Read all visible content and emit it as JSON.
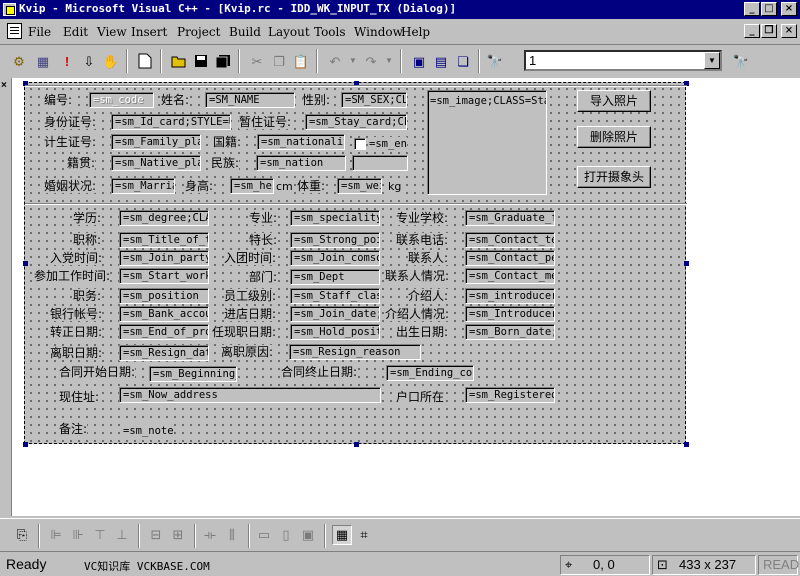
{
  "window": {
    "title": "Kvip - Microsoft Visual C++ - [Kvip.rc - IDD_WK_INPUT_TX (Dialog)]",
    "controls": {
      "minimize": "_",
      "maximize": "□",
      "close": "×"
    }
  },
  "menu": {
    "items": [
      "File",
      "Edit",
      "View",
      "Insert",
      "Project",
      "Build",
      "Layout",
      "Tools",
      "Window",
      "Help"
    ],
    "doc_controls": {
      "minimize": "_",
      "restore": "❐",
      "close": "×"
    }
  },
  "toolbar": {
    "combo_value": "1",
    "combo_arrow": "▼"
  },
  "dialog": {
    "labels": {
      "code": "编号:",
      "name": "姓名:",
      "sex": "性别:",
      "idcard": "身份证号:",
      "stay": "暂住证号:",
      "family": "计生证号:",
      "nationality": "国籍:",
      "native": "籍贯:",
      "nation": "民族:",
      "marriage": "婚姻状况:",
      "height": "身高:",
      "cm": "cm",
      "weight": "体重:",
      "kg": "kg",
      "degree": "学历:",
      "speciality": "专业:",
      "graduate": "专业学校:",
      "title": "职称:",
      "strong": "特长:",
      "phone": "联系电话:",
      "join_party": "入党时间:",
      "join_league": "入团时间:",
      "contact": "联系人:",
      "start_work": "参加工作时间:",
      "dept": "部门:",
      "contact_info": "联系人情况:",
      "position": "职务:",
      "staff_class": "员工级别:",
      "introducer": "介绍人:",
      "bank": "银行帐号:",
      "join_date": "进店日期:",
      "introducer_info": "介绍人情况:",
      "end_probation": "转正日期:",
      "hold_pos": "任现职日期:",
      "born": "出生日期:",
      "resign_date": "离职日期:",
      "resign_reason": "离职原因:",
      "contract_begin": "合同开始日期:",
      "contract_end": "合同终止日期:",
      "address": "现住址:",
      "registered": "户口所在",
      "note": "备注:"
    },
    "fields": {
      "code": "=sm_code",
      "name": "=SM_NAME",
      "sex": "=SM_SEX;CLASS",
      "idcard": "=sm_Id_card;STYLE=U",
      "stay": "=sm_Stay_card;CL",
      "family": "=sm_Family_plan",
      "nationality": "=sm_nationality",
      "en": "=sm_en",
      "native": "=sm_Native_place",
      "nation": "=sm_nation",
      "marriage": "=sm_Marriage",
      "height": "=sm_height",
      "weight": "=sm_weight",
      "degree": "=sm_degree;CLASS",
      "speciality": "=sm_speciality",
      "graduate": "=sm_Graduate_from",
      "title": "=sm_Title_of_tech",
      "strong": "=sm_Strong_point",
      "phone": "=sm_Contact_tel",
      "join_party": "=sm_Join_party_date",
      "join_league": "=sm_Join_comsomol",
      "contact": "=sm_Contact_person",
      "start_work": "=sm_Start_work",
      "dept": "=sm_Dept",
      "contact_info": "=sm_Contact_memo",
      "position": "=sm_position",
      "staff_class": "=sm_Staff_class",
      "introducer": "=sm_introducer",
      "bank": "=sm_Bank_account",
      "join_date": "=sm_Join_date;C",
      "introducer_info": "=sm_Introducer_memo",
      "end_probation": "=sm_End_of_probation",
      "hold_pos": "=sm_Hold_position",
      "born": "=sm_Born_date;C",
      "resign_date": "=sm_Resign_date",
      "resign_reason": "=sm_Resign_reason",
      "contract_begin": "=sm_Beginning_date",
      "contract_end": "=sm_Ending_contract",
      "address": "=sm_Now_address",
      "registered": "=sm_Registered",
      "note": "=sm_note",
      "image": "=sm_image;CLASS=Static"
    },
    "buttons": {
      "import_photo": "导入照片",
      "delete_photo": "删除照片",
      "open_camera": "打开摄象头"
    }
  },
  "status": {
    "ready": "Ready",
    "ad": "VC知识库 VCKBASE.COM",
    "position": "0, 0",
    "size": "433 x 237",
    "read": "READ"
  }
}
